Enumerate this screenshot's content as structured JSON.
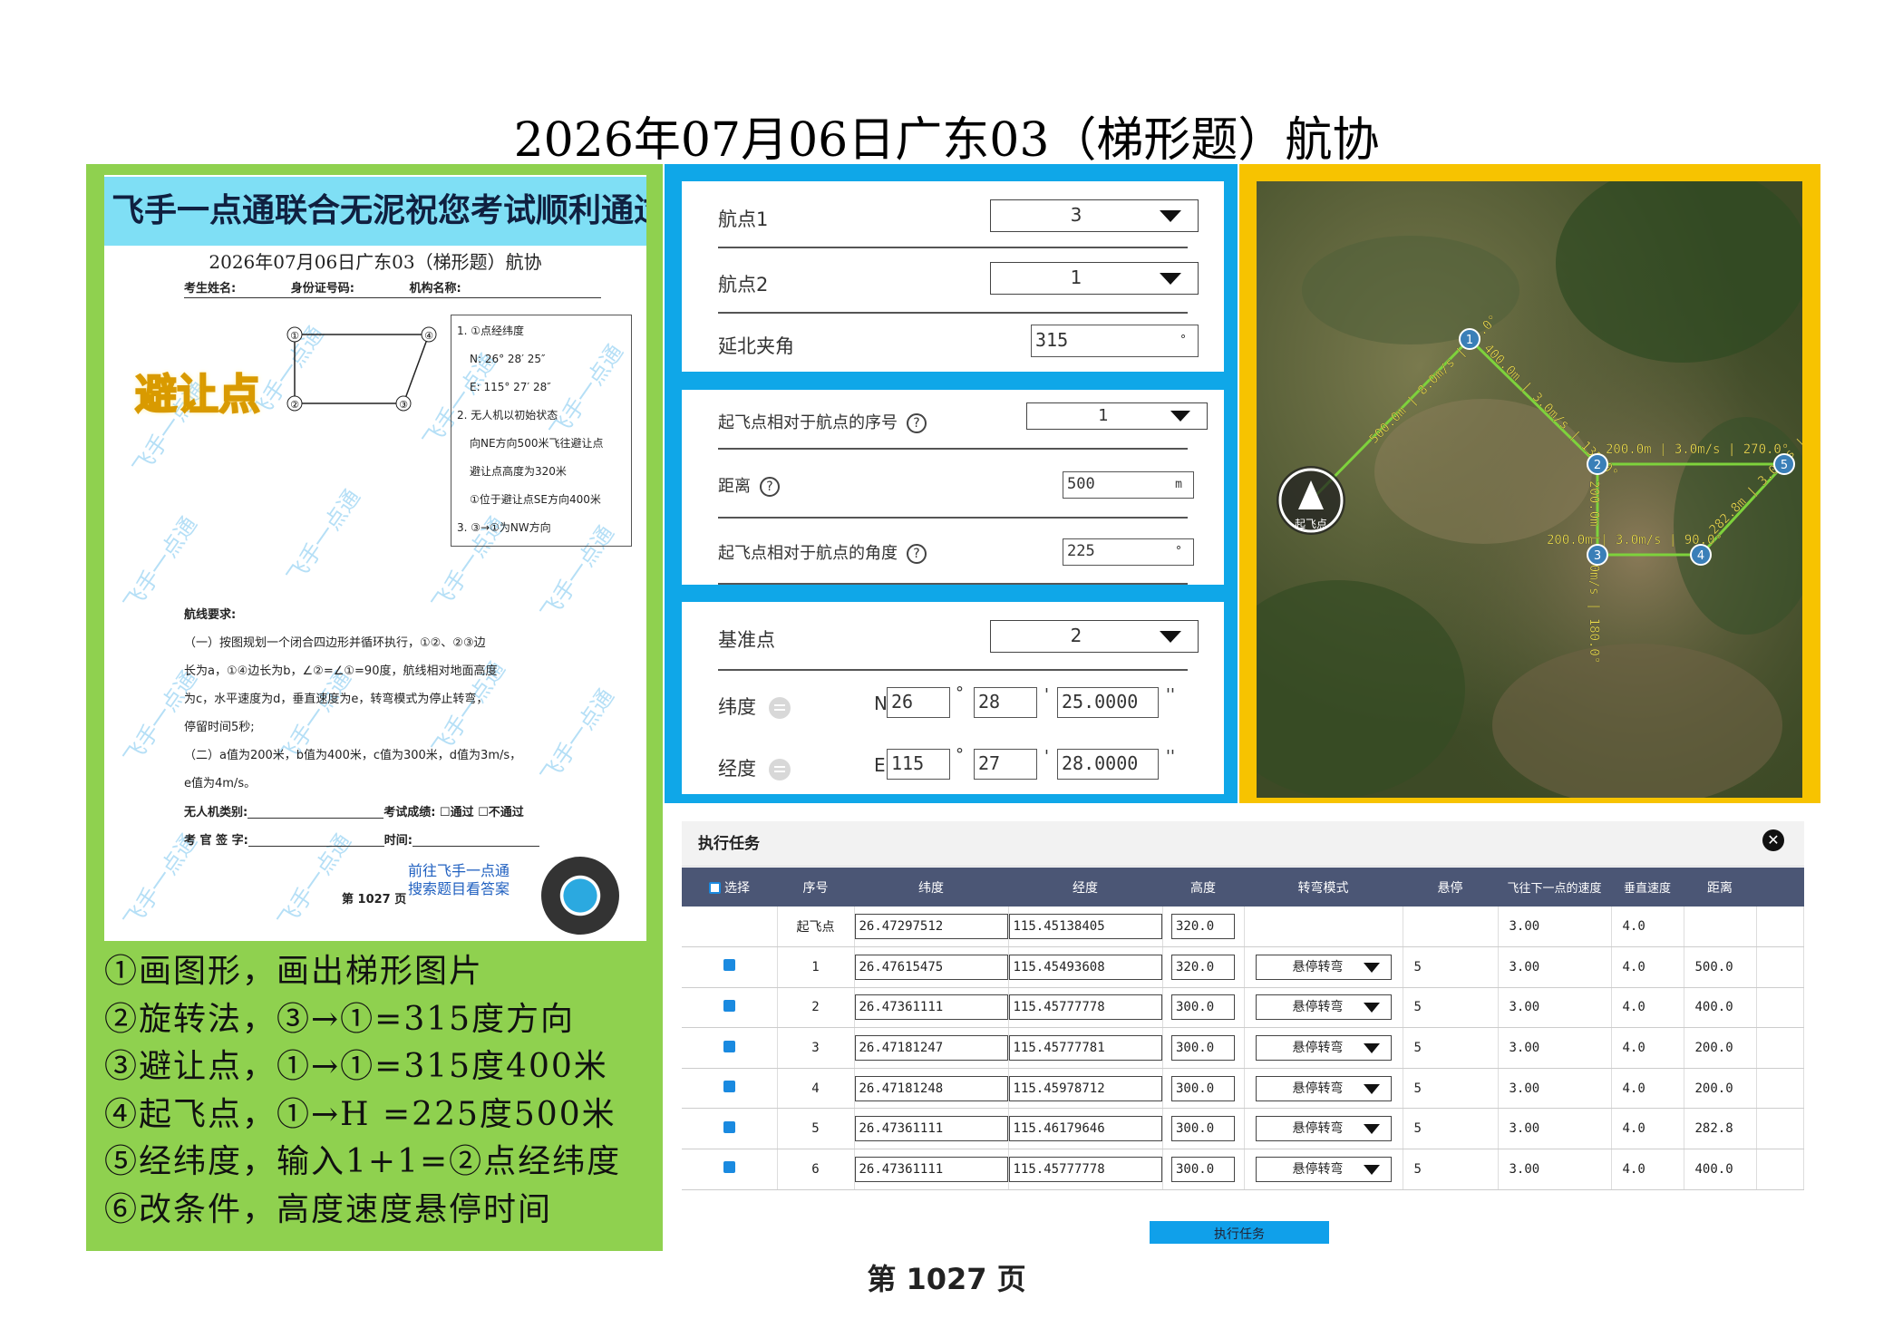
{
  "page": {
    "title": "2026年07月06日广东03（梯形题）航协",
    "footer": "第 1027 页"
  },
  "paper": {
    "banner": "飞手一点通联合无泥祝您考试顺利通过",
    "title": "2026年07月06日广东03（梯形题）航协",
    "fields": [
      "考生姓名:",
      "身份证号码:",
      "机构名称:"
    ],
    "avoid_label": "避让点",
    "watermark": "飞手一点通",
    "diagram_nodes": [
      "①",
      "④",
      "②",
      "③"
    ],
    "requirements": [
      "1. ①点经纬度",
      "N: 26° 28′ 25″",
      "E: 115° 27′ 28″",
      "2. 无人机以初始状态",
      "向NE方向500米飞往避让点",
      "避让点高度为320米",
      "①位于避让点SE方向400米",
      "3. ③→①为NW方向"
    ],
    "route_header": "航线要求:",
    "route_lines": [
      "（一）按图规划一个闭合四边形并循环执行，①②、②③边",
      "长为a，①④边长为b，∠②=∠①=90度，航线相对地面高度",
      "为c，水平速度为d，垂直速度为e，转弯模式为停止转弯，",
      "停留时间5秒;",
      "（二）a值为200米，b值为400米，c值为300米，d值为3m/s，",
      "e值为4m/s。"
    ],
    "sign_row1_a": "无人机类别:",
    "sign_row1_b": "考试成绩: ☐通过  ☐不通过",
    "sign_row2_a": "考 官 签 字:",
    "sign_row2_b": "时间:",
    "promo_line1": "前往飞手一点通",
    "promo_line2": "搜索题目看答案",
    "page_no": "第 1027 页"
  },
  "steps": [
    "①画图形，画出梯形图片",
    "②旋转法，③→①=315度方向",
    "③避让点，①→①=315度400米",
    "④起飞点，①→H =225度500米",
    "⑤经纬度，输入1+1=②点经纬度",
    "⑥改条件，高度速度悬停时间"
  ],
  "card1": {
    "wp1_label": "航点1",
    "wp1_value": "3",
    "wp2_label": "航点2",
    "wp2_value": "1",
    "angle_label": "延北夹角",
    "angle_value": "315",
    "angle_unit": "°"
  },
  "card2": {
    "seq_label": "起飞点相对于航点的序号",
    "seq_value": "1",
    "dist_label": "距离",
    "dist_value": "500",
    "dist_unit": "m",
    "ang_label": "起飞点相对于航点的角度",
    "ang_value": "225",
    "ang_unit": "°",
    "help_icon": "?"
  },
  "card3": {
    "base_label": "基准点",
    "base_value": "2",
    "lat_label": "纬度",
    "lat_hemi": "N",
    "lat_deg": "26",
    "lat_min": "28",
    "lat_sec": "25.0000",
    "lon_label": "经度",
    "lon_hemi": "E",
    "lon_deg": "115",
    "lon_min": "27",
    "lon_sec": "28.0000",
    "deg_sym": "°",
    "min_sym": "'",
    "sec_sym": "''"
  },
  "map": {
    "home_label": "起飞点",
    "waypoints": [
      "1",
      "2",
      "3",
      "4",
      "5"
    ],
    "seg_labels": [
      "500.0m | 8.0m/s | 45.0°",
      "400.0m | 3.0m/s | 135.0°",
      "200.0m | 3.0m/s | 270.0°",
      "200.0m | 3.0m/s | 180.0°",
      "200.0m | 3.0m/s | 90.0°",
      "282.8m | 3.0m/s | 45.0°"
    ]
  },
  "task": {
    "title": "执行任务",
    "close_icon": "✕",
    "columns": [
      "选择",
      "序号",
      "纬度",
      "经度",
      "高度",
      "转弯模式",
      "悬停",
      "飞往下一点的速度",
      "垂直速度",
      "距离"
    ],
    "takeoff": {
      "seq": "起飞点",
      "lat": "26.47297512",
      "lon": "115.45138405",
      "alt": "320.0",
      "speed": "3.00",
      "vspeed": "4.0"
    },
    "rows": [
      {
        "seq": "1",
        "lat": "26.47615475",
        "lon": "115.45493608",
        "alt": "320.0",
        "turn": "悬停转弯",
        "hover": "5",
        "speed": "3.00",
        "vspeed": "4.0",
        "dist": "500.0"
      },
      {
        "seq": "2",
        "lat": "26.47361111",
        "lon": "115.45777778",
        "alt": "300.0",
        "turn": "悬停转弯",
        "hover": "5",
        "speed": "3.00",
        "vspeed": "4.0",
        "dist": "400.0"
      },
      {
        "seq": "3",
        "lat": "26.47181247",
        "lon": "115.45777781",
        "alt": "300.0",
        "turn": "悬停转弯",
        "hover": "5",
        "speed": "3.00",
        "vspeed": "4.0",
        "dist": "200.0"
      },
      {
        "seq": "4",
        "lat": "26.47181248",
        "lon": "115.45978712",
        "alt": "300.0",
        "turn": "悬停转弯",
        "hover": "5",
        "speed": "3.00",
        "vspeed": "4.0",
        "dist": "200.0"
      },
      {
        "seq": "5",
        "lat": "26.47361111",
        "lon": "115.46179646",
        "alt": "300.0",
        "turn": "悬停转弯",
        "hover": "5",
        "speed": "3.00",
        "vspeed": "4.0",
        "dist": "282.8"
      },
      {
        "seq": "6",
        "lat": "26.47361111",
        "lon": "115.45777778",
        "alt": "300.0",
        "turn": "悬停转弯",
        "hover": "5",
        "speed": "3.00",
        "vspeed": "4.0",
        "dist": "400.0"
      }
    ],
    "exec_button": "执行任务"
  },
  "colors": {
    "green_panel": "#8fd14f",
    "blue_panel": "#0fa7e8",
    "yellow_panel": "#f7c300",
    "table_header": "#4b5675"
  }
}
